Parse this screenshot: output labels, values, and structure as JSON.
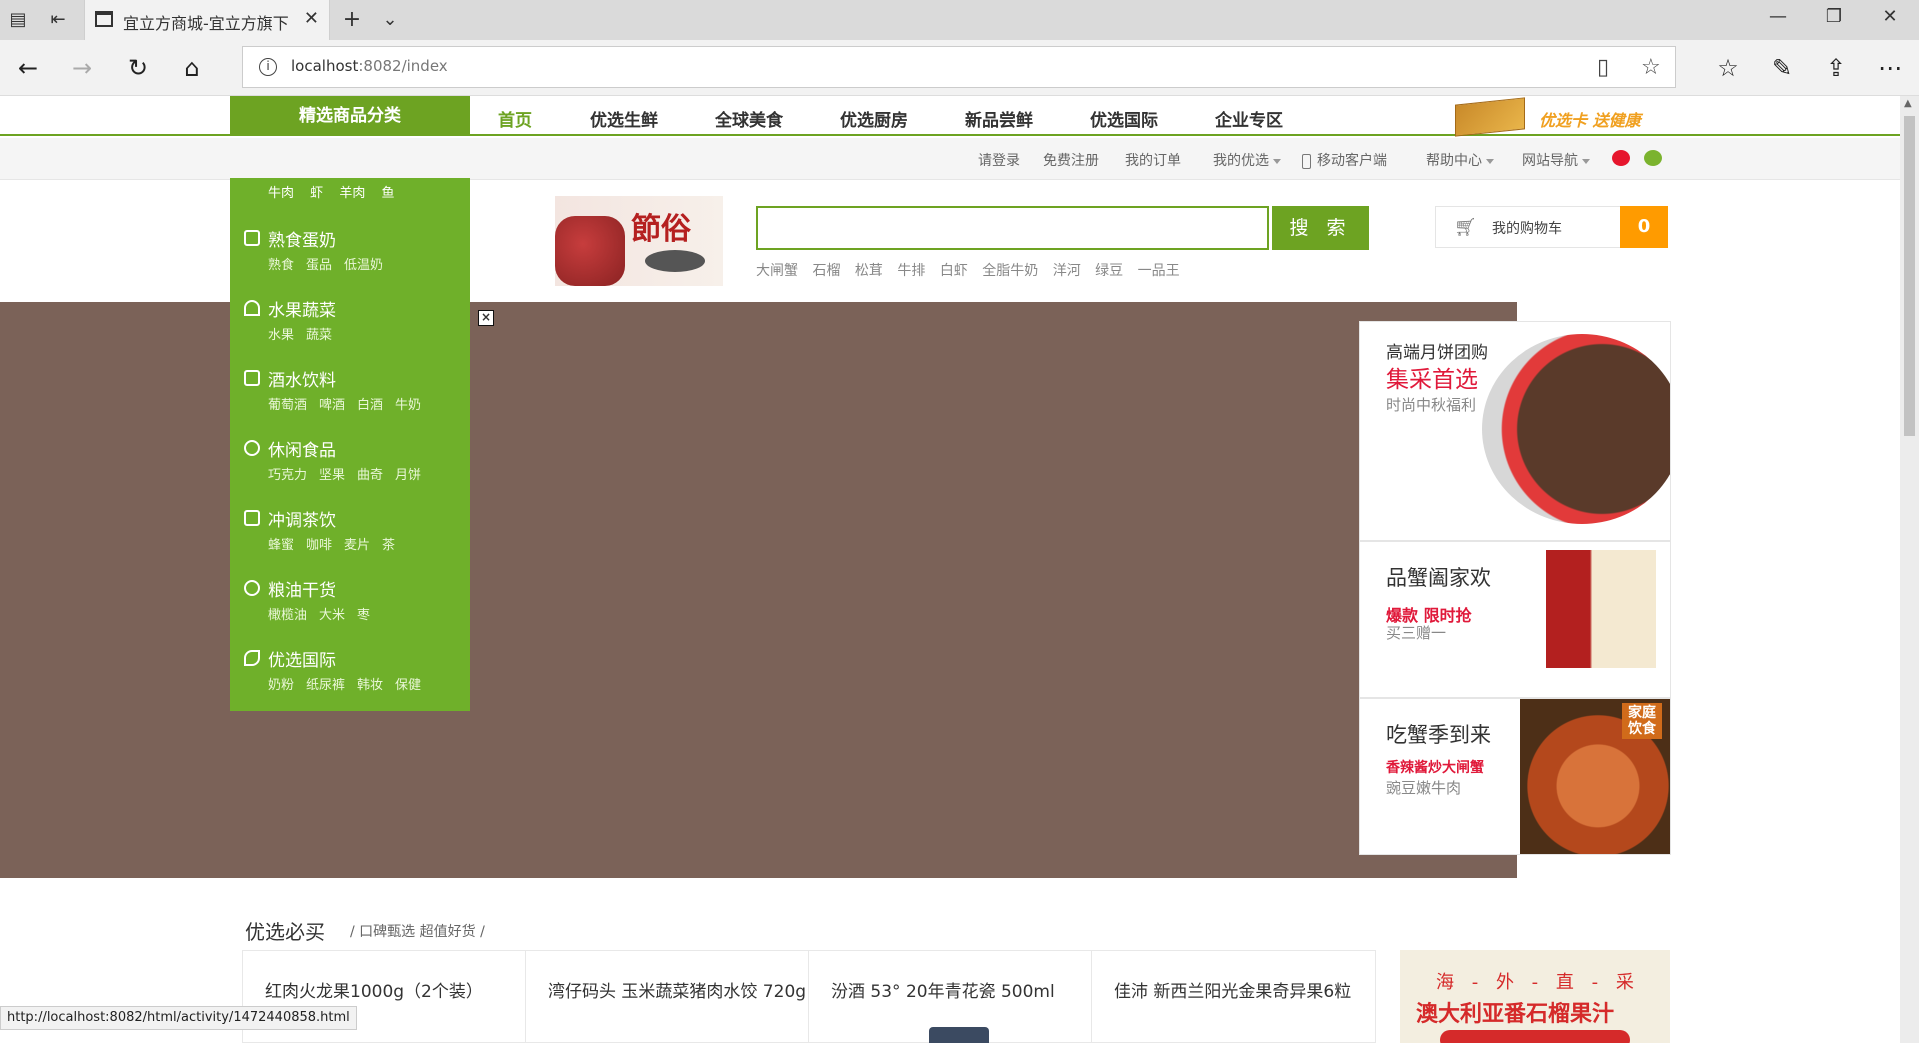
{
  "browser": {
    "tab_title": "宜立方商城-宜立方旗下",
    "url_host": "localhost",
    "url_path": ":8082/index",
    "status_url": "http://localhost:8082/html/activity/1472440858.html"
  },
  "nav": {
    "category_header": "精选商品分类",
    "items": [
      "首页",
      "优选生鲜",
      "全球美食",
      "优选厨房",
      "新品尝鲜",
      "优选国际",
      "企业专区"
    ],
    "card_promo": "优选卡 送健康"
  },
  "topbar": {
    "login": "请登录",
    "register": "免费注册",
    "orders": "我的订单",
    "my_youxuan": "我的优选",
    "mobile": "移动客户端",
    "help": "帮助中心",
    "site_nav": "网站导航"
  },
  "header": {
    "promo_char": "節俗",
    "search_placeholder": "",
    "search_button": "搜 索",
    "hot_words": [
      "大闸蟹",
      "石榴",
      "松茸",
      "牛排",
      "白虾",
      "全脂牛奶",
      "洋河",
      "绿豆",
      "一品王"
    ],
    "cart_label": "我的购物车",
    "cart_count": "0",
    "stray_char": "家"
  },
  "sidebar": {
    "top_row": [
      "牛肉",
      "虾",
      "羊肉",
      "鱼"
    ],
    "categories": [
      {
        "name": "熟食蛋奶",
        "subs": [
          "熟食",
          "蛋品",
          "低温奶"
        ]
      },
      {
        "name": "水果蔬菜",
        "subs": [
          "水果",
          "蔬菜"
        ]
      },
      {
        "name": "酒水饮料",
        "subs": [
          "葡萄酒",
          "啤酒",
          "白酒",
          "牛奶"
        ]
      },
      {
        "name": "休闲食品",
        "subs": [
          "巧克力",
          "坚果",
          "曲奇",
          "月饼"
        ]
      },
      {
        "name": "冲调茶饮",
        "subs": [
          "蜂蜜",
          "咖啡",
          "麦片",
          "茶"
        ]
      },
      {
        "name": "粮油干货",
        "subs": [
          "橄榄油",
          "大米",
          "枣"
        ]
      },
      {
        "name": "优选国际",
        "subs": [
          "奶粉",
          "纸尿裤",
          "韩妆",
          "保健"
        ]
      }
    ]
  },
  "side_ads": [
    {
      "l1": "高端月饼团购",
      "l2": "集采首选",
      "l3": "时尚中秋福利"
    },
    {
      "l1": "品蟹阖家欢",
      "l2": "爆款 限时抢",
      "l3": "买三赠一"
    },
    {
      "l1": "吃蟹季到来",
      "l2": "香辣酱炒大闸蟹",
      "l3": "豌豆嫩牛肉",
      "tag": "家庭饮食"
    }
  ],
  "section": {
    "title": "优选必买",
    "sub": "/ 口碑甄选  超值好货 /"
  },
  "products": [
    "红肉火龙果1000g（2个装）",
    "湾仔码头 玉米蔬菜猪肉水饺 720g",
    "汾酒 53° 20年青花瓷 500ml",
    "佳沛  新西兰阳光金果奇异果6粒"
  ],
  "intl_ad": {
    "line1": "海 - 外 - 直 - 采",
    "line2": "澳大利亚番石榴果汁"
  },
  "colors": {
    "brand_green": "#6da322",
    "orange": "#ff9b00",
    "banner_bg": "#7b6258"
  }
}
